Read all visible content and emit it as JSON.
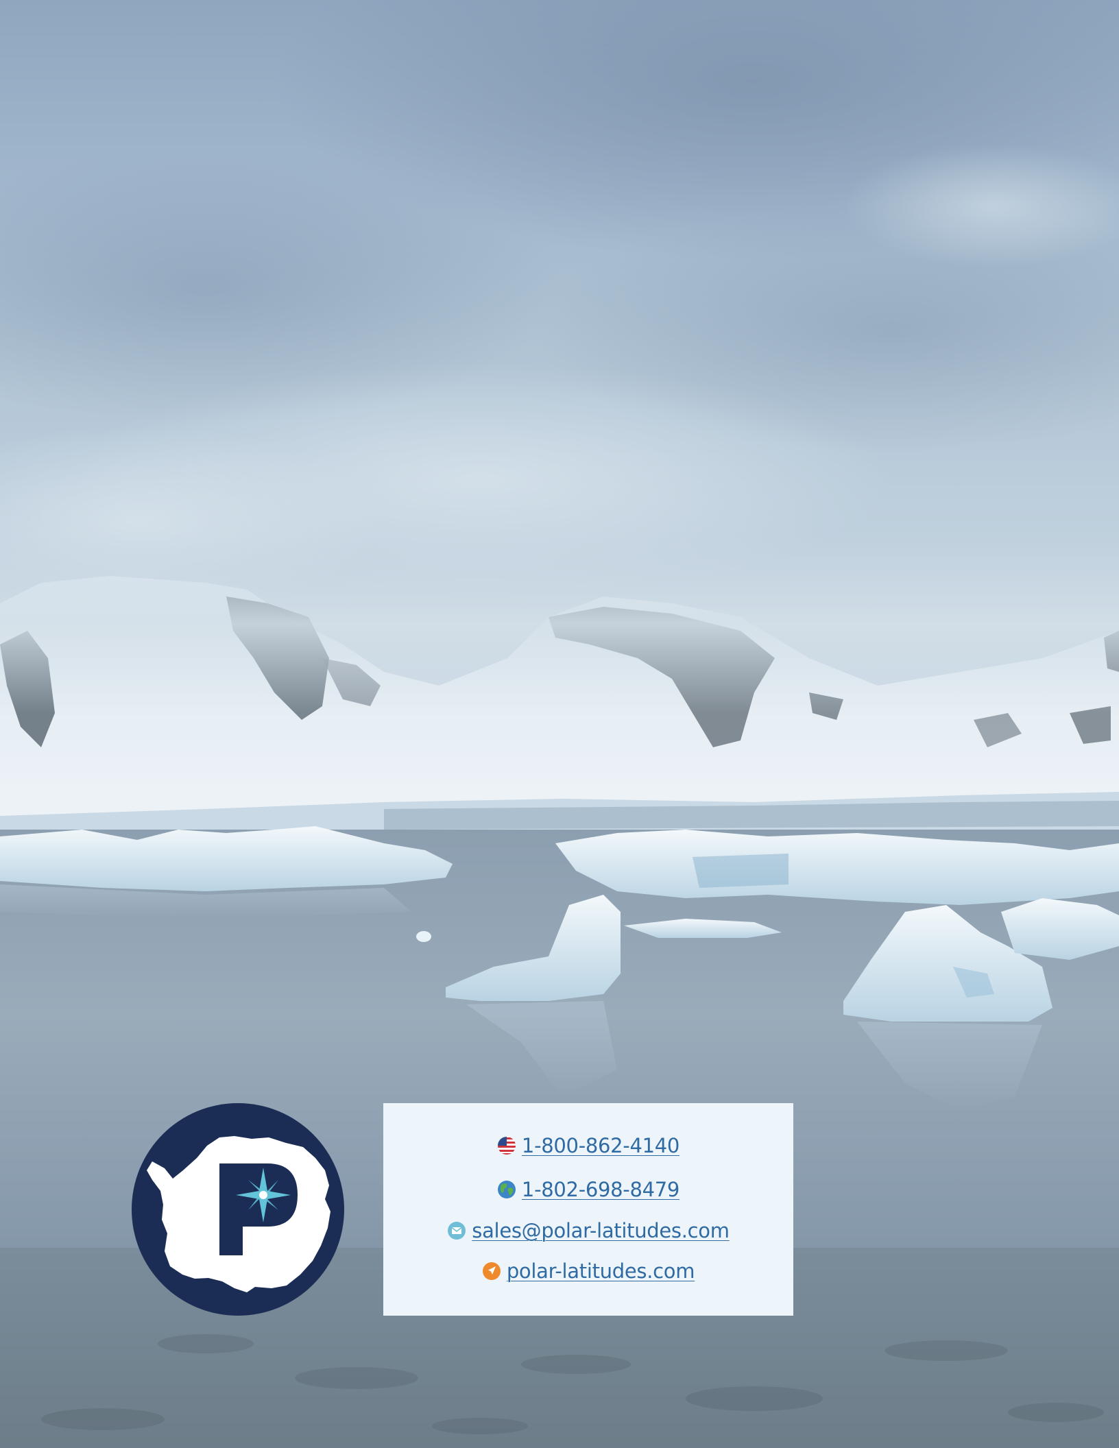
{
  "logo": {
    "icon": "polar-latitudes-logo",
    "letter": "P",
    "colors": {
      "navy": "#1b2d55",
      "compass": "#63c3d8",
      "white": "#ffffff"
    }
  },
  "contact": {
    "items": [
      {
        "icon": "us-flag-icon",
        "text": "1-800-862-4140"
      },
      {
        "icon": "globe-icon",
        "text": "1-802-698-8479"
      },
      {
        "icon": "envelope-icon",
        "text": "sales@polar-latitudes.com"
      },
      {
        "icon": "compass-arrow-icon",
        "text": "polar-latitudes.com"
      }
    ],
    "colors": {
      "background": "#edf5fa",
      "link": "#2f6aa3",
      "email_icon": "#6fbdd6",
      "web_icon": "#ee8a2c"
    }
  }
}
